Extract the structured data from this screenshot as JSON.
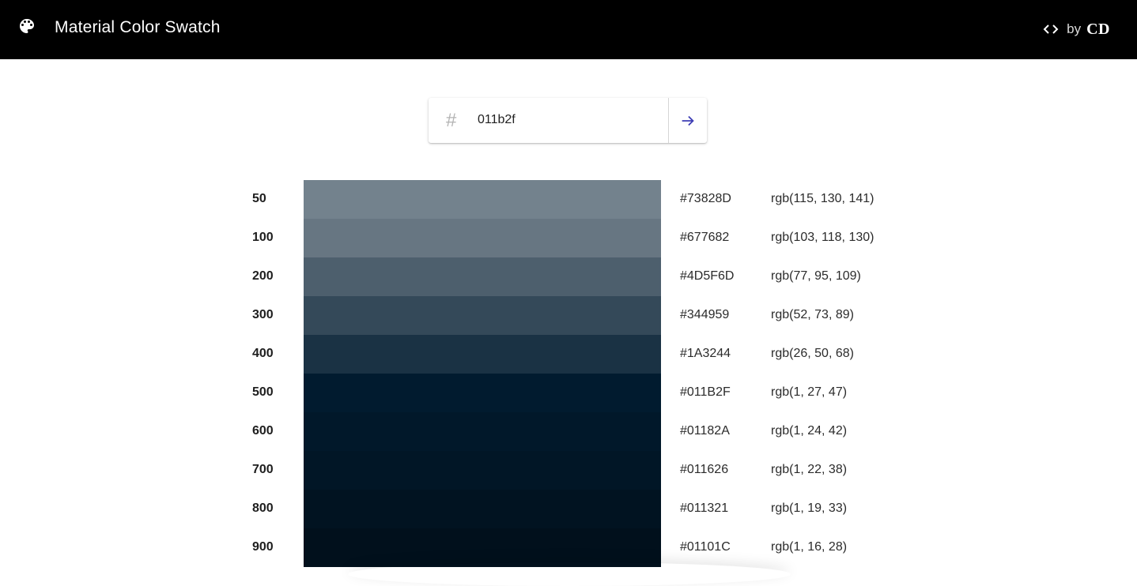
{
  "header": {
    "title": "Material Color Swatch",
    "icon": "palette-icon",
    "credit_icon": "code-icon",
    "by_label": "by",
    "author": "CD"
  },
  "search": {
    "prefix": "#",
    "value": "011b2f",
    "submit_icon": "arrow-right-icon",
    "accent_color": "#3f3fb5"
  },
  "swatches": [
    {
      "shade": "50",
      "hex": "#73828D",
      "rgb": "rgb(115, 130, 141)"
    },
    {
      "shade": "100",
      "hex": "#677682",
      "rgb": "rgb(103, 118, 130)"
    },
    {
      "shade": "200",
      "hex": "#4D5F6D",
      "rgb": "rgb(77, 95, 109)"
    },
    {
      "shade": "300",
      "hex": "#344959",
      "rgb": "rgb(52, 73, 89)"
    },
    {
      "shade": "400",
      "hex": "#1A3244",
      "rgb": "rgb(26, 50, 68)"
    },
    {
      "shade": "500",
      "hex": "#011B2F",
      "rgb": "rgb(1, 27, 47)"
    },
    {
      "shade": "600",
      "hex": "#01182A",
      "rgb": "rgb(1, 24, 42)"
    },
    {
      "shade": "700",
      "hex": "#011626",
      "rgb": "rgb(1, 22, 38)"
    },
    {
      "shade": "800",
      "hex": "#011321",
      "rgb": "rgb(1, 19, 33)"
    },
    {
      "shade": "900",
      "hex": "#01101C",
      "rgb": "rgb(1, 16, 28)"
    }
  ]
}
